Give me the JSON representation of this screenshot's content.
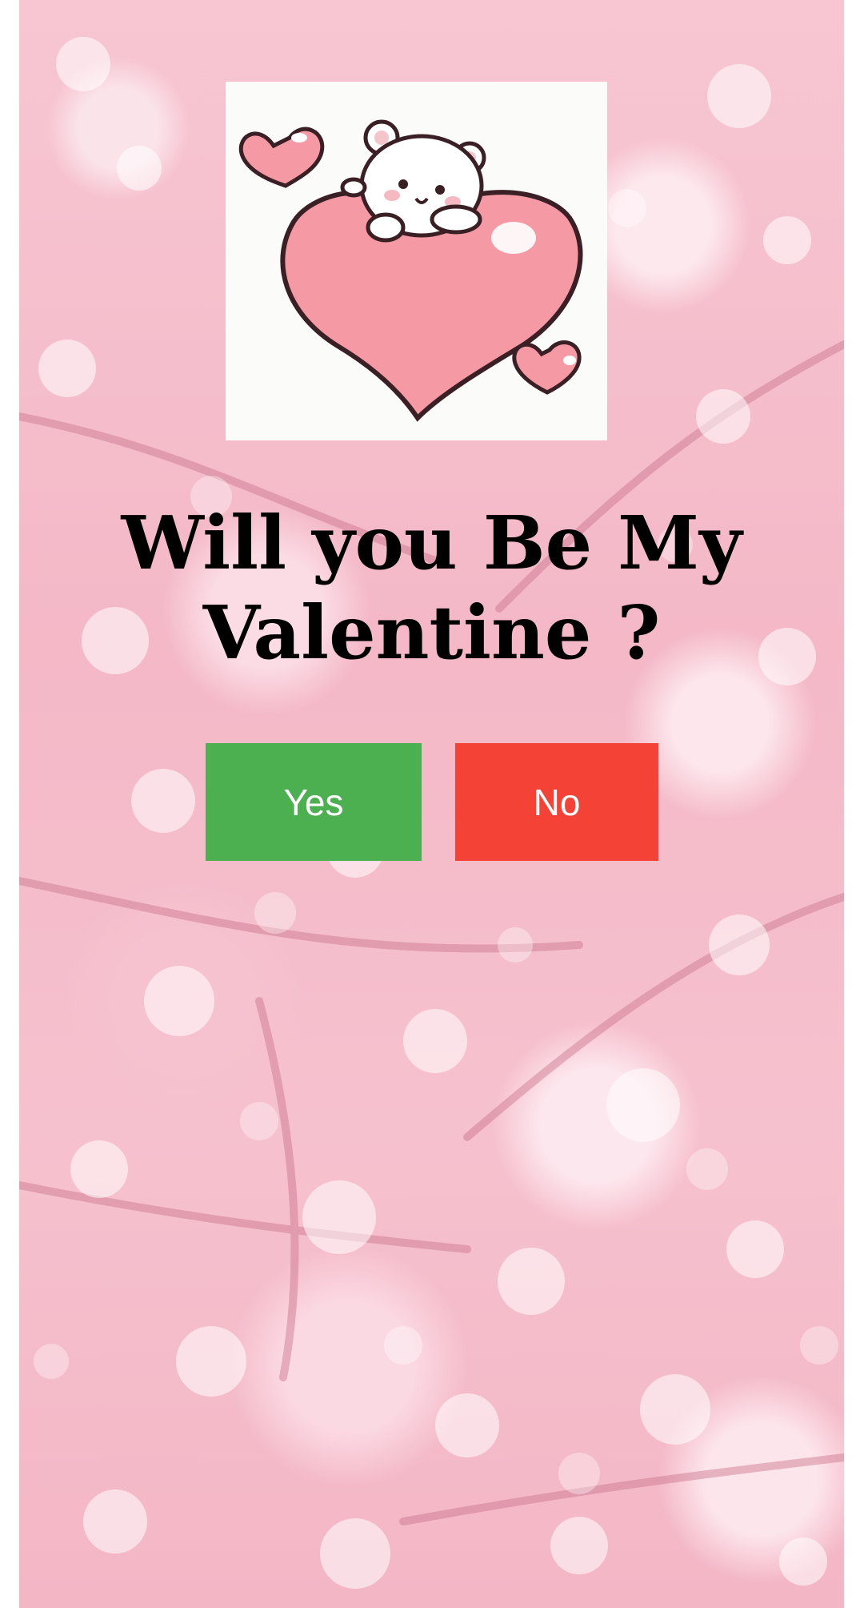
{
  "title": "Will you Be My Valentine ?",
  "illustration": {
    "icon": "bear-hugging-heart-icon"
  },
  "buttons": {
    "yes_label": "Yes",
    "no_label": "No"
  },
  "colors": {
    "yes": "#4caf50",
    "no": "#f44336",
    "heart": "#f59aa4",
    "background": "#f7c6d2"
  }
}
